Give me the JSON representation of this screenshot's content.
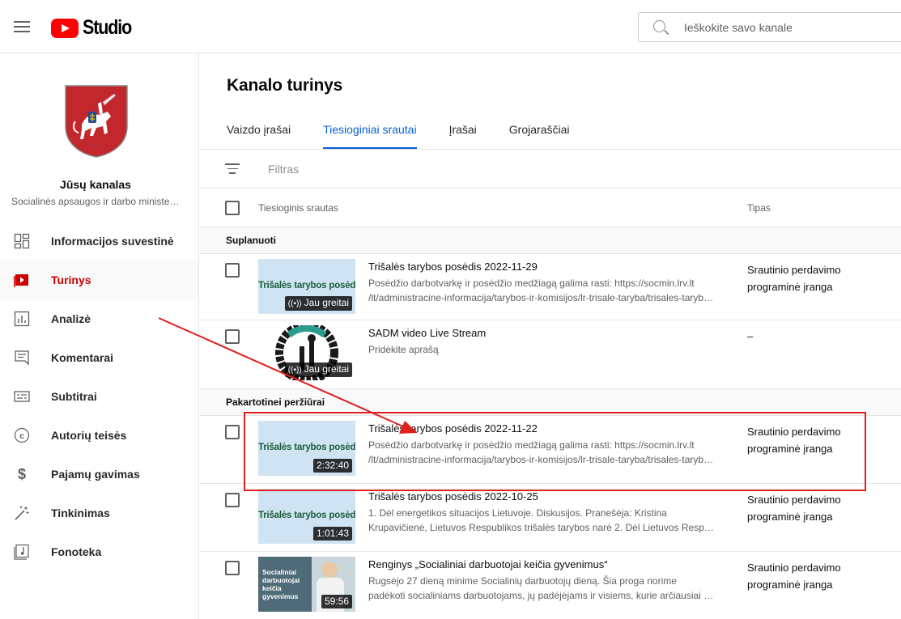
{
  "header": {
    "menu_icon": "hamburger-menu-icon",
    "logo_text": "Studio",
    "search": {
      "placeholder": "Ieškokite savo kanale",
      "icon": "search-icon"
    }
  },
  "sidebar": {
    "channel_title": "Jūsų kanalas",
    "channel_name": "Socialinės apsaugos ir darbo ministerija",
    "items": [
      {
        "label": "Informacijos suvestinė",
        "icon": "dashboard-icon",
        "active": false
      },
      {
        "label": "Turinys",
        "icon": "content-icon",
        "active": true
      },
      {
        "label": "Analizė",
        "icon": "analytics-icon",
        "active": false
      },
      {
        "label": "Komentarai",
        "icon": "comments-icon",
        "active": false
      },
      {
        "label": "Subtitrai",
        "icon": "subtitles-icon",
        "active": false
      },
      {
        "label": "Autorių teisės",
        "icon": "copyright-icon",
        "active": false
      },
      {
        "label": "Pajamų gavimas",
        "icon": "monetization-icon",
        "active": false
      },
      {
        "label": "Tinkinimas",
        "icon": "customization-icon",
        "active": false
      },
      {
        "label": "Fonoteka",
        "icon": "audio-library-icon",
        "active": false
      }
    ]
  },
  "main": {
    "title": "Kanalo turinys",
    "tabs": [
      {
        "label": "Vaizdo įrašai",
        "active": false
      },
      {
        "label": "Tiesioginiai srautai",
        "active": true
      },
      {
        "label": "Įrašai",
        "active": false
      },
      {
        "label": "Grojaraščiai",
        "active": false
      }
    ],
    "filter_placeholder": "Filtras",
    "columns": {
      "stream": "Tiesioginis srautas",
      "type": "Tipas"
    },
    "sections": [
      {
        "label": "Suplanuoti",
        "rows": [
          {
            "thumb_text": "Trišalės tarybos posėdis",
            "badge": "Jau greitai",
            "title": "Trišalės tarybos posėdis 2022-11-29",
            "desc_line1": "Posėdžio darbotvarkę ir posėdžio medžiagą galima rasti: https://socmin.lrv.lt",
            "desc_line2": "/lt/administracine-informacija/tarybos-ir-komisijos/lr-trisale-taryba/trisales-tarybos-posedziai",
            "type_line1": "Srautinio perdavimo",
            "type_line2": "programinė įranga"
          },
          {
            "thumb_text": "",
            "badge": "Jau greitai",
            "title": "SADM video Live Stream",
            "desc_line1": "Pridėkite aprašą",
            "desc_line2": "",
            "type_line1": "–",
            "type_line2": ""
          }
        ]
      },
      {
        "label": "Pakartotinei peržiūrai",
        "rows": [
          {
            "thumb_text": "Trišalės tarybos posėdis",
            "badge": "2:32:40",
            "title": "Trišalės tarybos posėdis 2022-11-22",
            "desc_line1": "Posėdžio darbotvarkę ir posėdžio medžiagą galima rasti: https://socmin.lrv.lt",
            "desc_line2": "/lt/administracine-informacija/tarybos-ir-komisijos/lr-trisale-taryba/trisales-tarybos-posedziai",
            "type_line1": "Srautinio perdavimo",
            "type_line2": "programinė įranga"
          },
          {
            "thumb_text": "Trišalės tarybos posėdis",
            "badge": "1:01:43",
            "title": "Trišalės tarybos posėdis 2022-10-25",
            "desc_line1": "1. Dėl energetikos situacijos Lietuvoje. Diskusijos. Pranešėja: Kristina",
            "desc_line2": "Krupavičienė, Lietuvos Respublikos trišalės tarybos narė 2. Dėl Lietuvos Respublikos",
            "type_line1": "Srautinio perdavimo",
            "type_line2": "programinė įranga"
          },
          {
            "thumb_text": "Socialiniai darbuotojai keičia gyvenimus",
            "badge": "59:56",
            "title": "Renginys „Socialiniai darbuotojai keičia gyvenimus“",
            "desc_line1": "Rugsėjo 27 dieną minime Socialinių darbuotojų dieną. Šia proga norime",
            "desc_line2": "padėkoti socialiniams darbuotojams, jų padėjėjams ir visiems, kurie arčiausiai žmonių",
            "type_line1": "Srautinio perdavimo",
            "type_line2": "programinė įranga"
          }
        ]
      }
    ]
  },
  "colors": {
    "brand_red": "#ff0000",
    "active_red": "#cc0000",
    "tab_blue": "#065fd4",
    "annotation_red": "#e01f1f"
  }
}
